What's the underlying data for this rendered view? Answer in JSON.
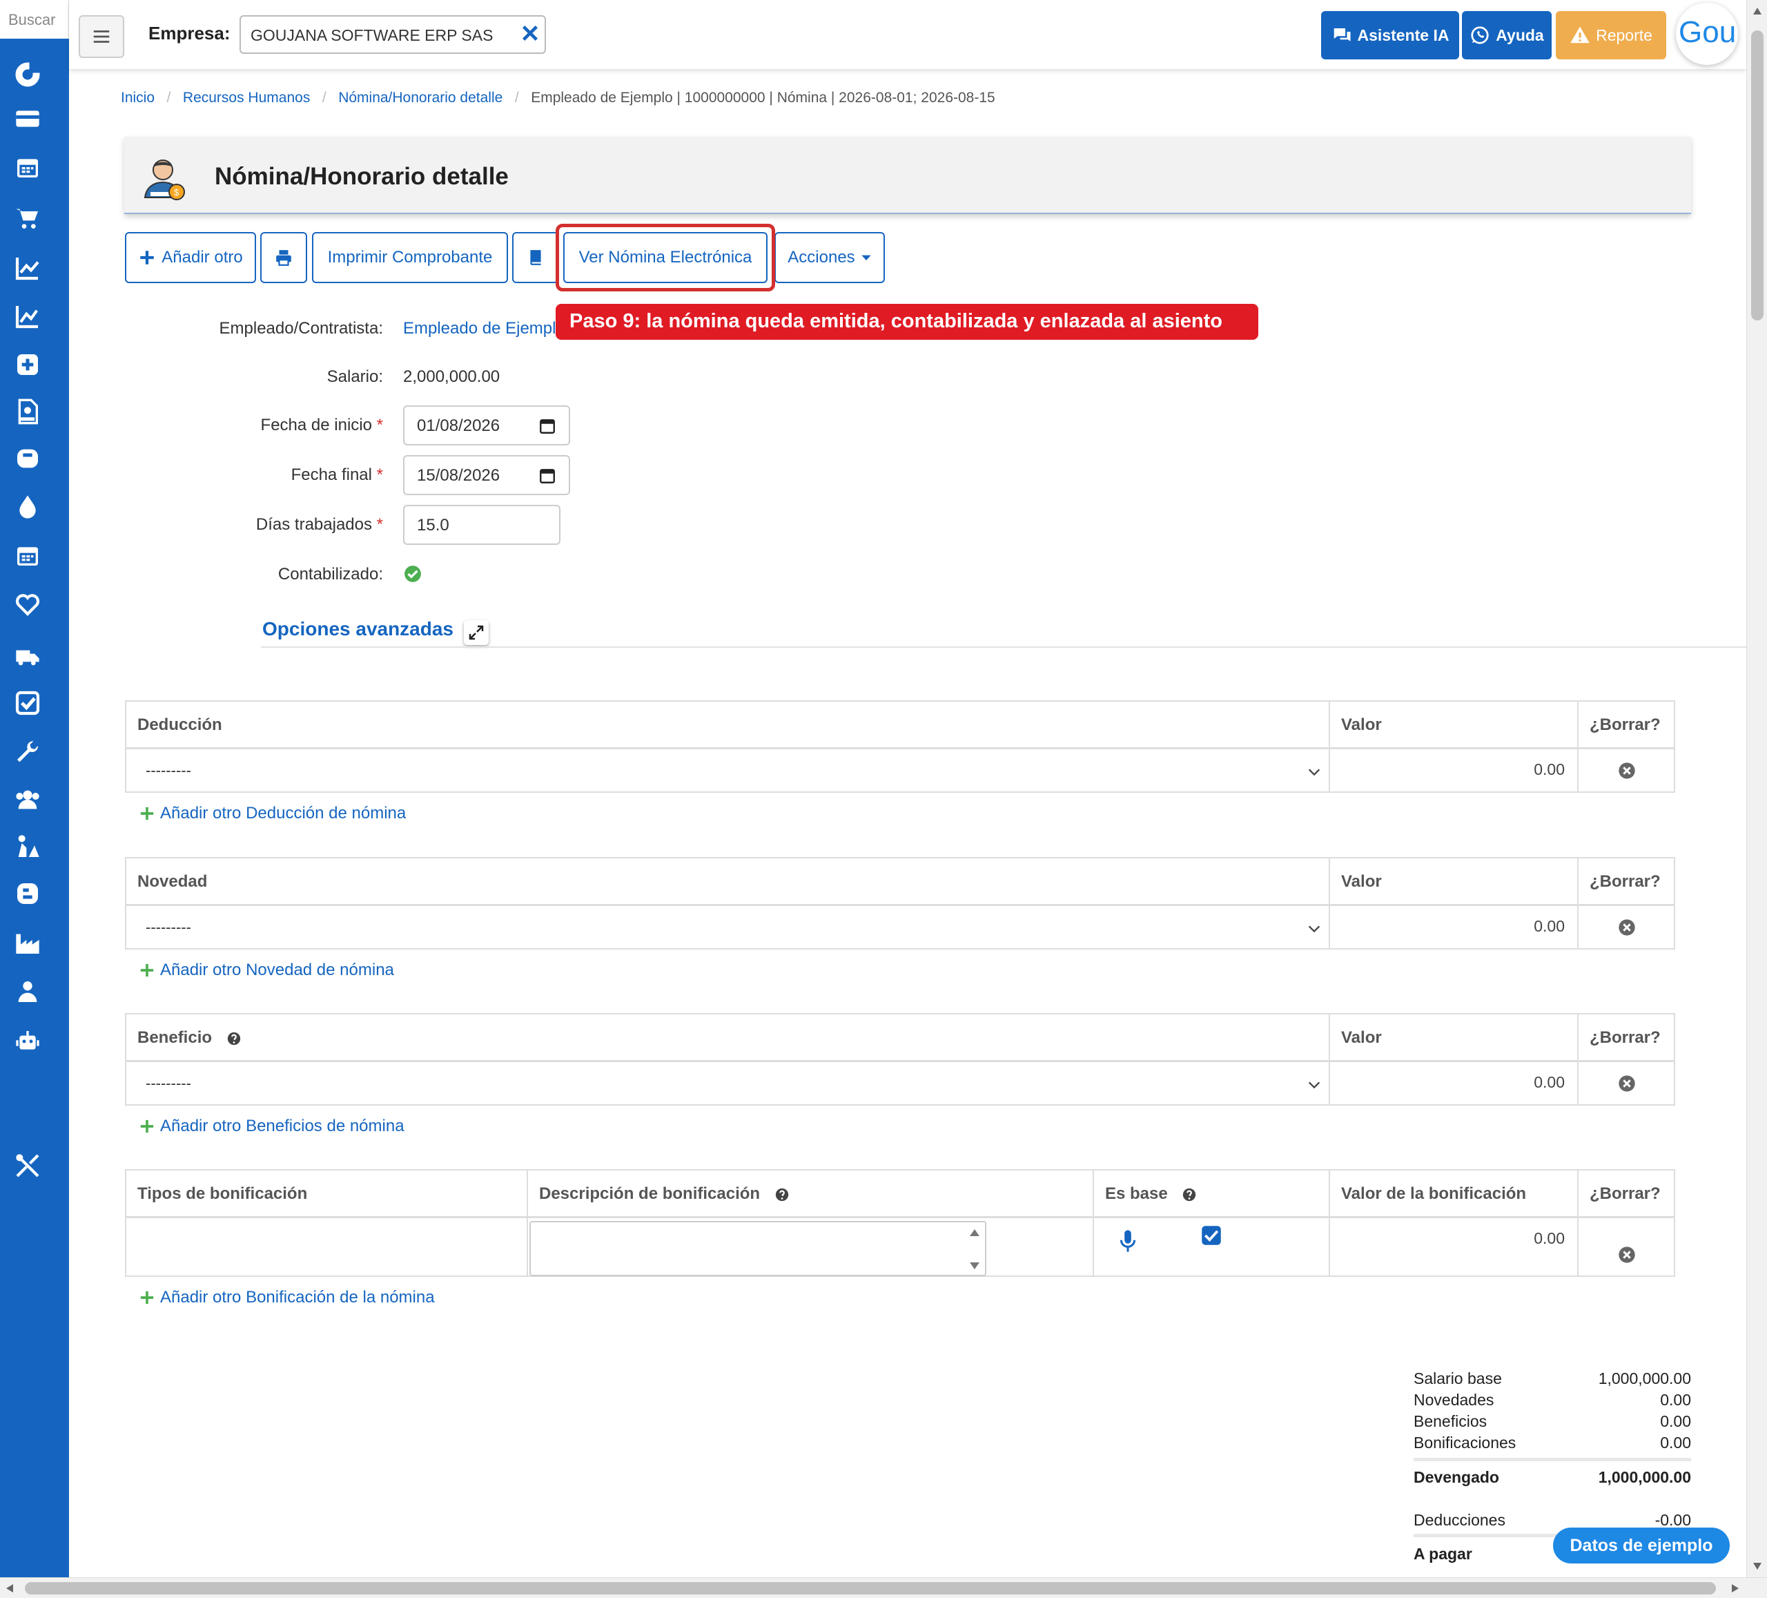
{
  "sidebar": {
    "search_label": "Buscar",
    "icons": [
      "refresh-icon",
      "credit-card-icon",
      "calendar-icon",
      "cart-icon",
      "chart-line-icon",
      "chart-area-icon",
      "plus-square-icon",
      "rips-file-icon",
      "tooth-icon",
      "droplet-icon",
      "calendar-grid-icon",
      "heart-icon",
      "truck-icon",
      "checkbox-icon",
      "wrench-icon",
      "users-icon",
      "worker-icon",
      "blogger-icon",
      "factory-icon",
      "doctor-icon",
      "robot-icon",
      "tools-icon"
    ]
  },
  "header": {
    "empresa_label": "Empresa:",
    "empresa_value": "GOUJANA SOFTWARE ERP SAS",
    "buttons": {
      "asistente": "Asistente IA",
      "ayuda": "Ayuda",
      "reporte": "Reporte"
    },
    "logo_text": "Gou",
    "colors": {
      "primary": "#1565c0",
      "reporte": "#f0ad4e"
    }
  },
  "breadcrumb": {
    "items": [
      "Inicio",
      "Recursos Humanos",
      "Nómina/Honorario detalle"
    ],
    "current": "Empleado de Ejemplo | 1000000000 | Nómina | 2026-08-01; 2026-08-15"
  },
  "page": {
    "title": "Nómina/Honorario detalle"
  },
  "actions": {
    "add": "Añadir otro",
    "print_voucher": "Imprimir Comprobante",
    "view_electronic": "Ver Nómina Electrónica",
    "actions_menu": "Acciones"
  },
  "tooltip": "Paso 9: la nómina queda emitida, contabilizada y enlazada al asiento",
  "form": {
    "employee_label": "Empleado/Contratista:",
    "employee_value": "Empleado de Ejempl",
    "salary_label": "Salario:",
    "salary_value": "2,000,000.00",
    "start_label": "Fecha de inicio",
    "start_value": "01/08/2026",
    "end_label": "Fecha final",
    "end_value": "15/08/2026",
    "days_label": "Días trabajados",
    "days_value": "15.0",
    "accounted_label": "Contabilizado:",
    "required_mark": "*"
  },
  "advanced": {
    "title": "Opciones avanzadas"
  },
  "tables": {
    "deduccion": {
      "headers": [
        "Deducción",
        "Valor",
        "¿Borrar?"
      ],
      "row": {
        "select": "---------",
        "valor": "0.00"
      },
      "add_link": "Añadir otro Deducción de nómina"
    },
    "novedad": {
      "headers": [
        "Novedad",
        "Valor",
        "¿Borrar?"
      ],
      "row": {
        "select": "---------",
        "valor": "0.00"
      },
      "add_link": "Añadir otro Novedad de nómina"
    },
    "beneficio": {
      "headers": [
        "Beneficio",
        "Valor",
        "¿Borrar?"
      ],
      "row": {
        "select": "---------",
        "valor": "0.00"
      },
      "add_link": "Añadir otro Beneficios de nómina"
    },
    "bonificacion": {
      "headers": [
        "Tipos de bonificación",
        "Descripción de bonificación",
        "Es base",
        "Valor de la bonificación",
        "¿Borrar?"
      ],
      "row": {
        "valor": "0.00",
        "es_base": true
      },
      "add_link": "Añadir otro Bonificación de la nómina"
    }
  },
  "totals": {
    "rows": [
      {
        "label": "Salario base",
        "value": "1,000,000.00"
      },
      {
        "label": "Novedades",
        "value": "0.00"
      },
      {
        "label": "Beneficios",
        "value": "0.00"
      },
      {
        "label": "Bonificaciones",
        "value": "0.00"
      }
    ],
    "devengado_label": "Devengado",
    "devengado_value": "1,000,000.00",
    "deducciones_label": "Deducciones",
    "deducciones_value": "-0.00",
    "apagar_label": "A pagar"
  },
  "sample_badge": "Datos de ejemplo"
}
